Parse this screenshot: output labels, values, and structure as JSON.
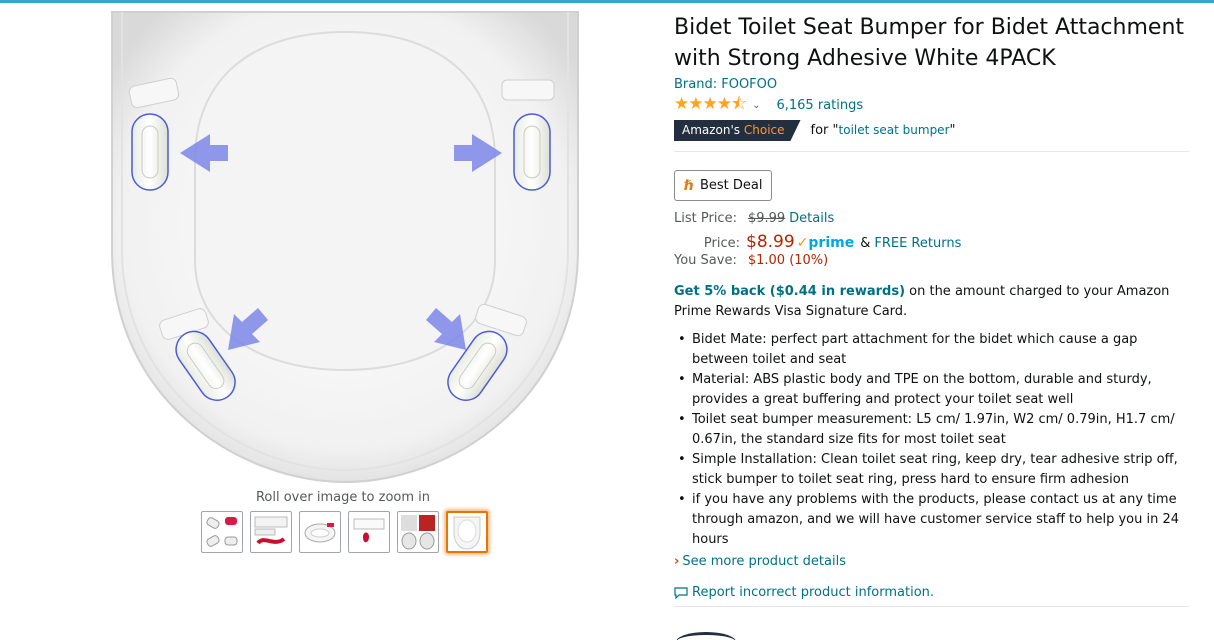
{
  "image": {
    "zoom_hint": "Roll over image to zoom in",
    "thumbnails": [
      {
        "name": "thumb-1",
        "selected": false
      },
      {
        "name": "thumb-2",
        "selected": false
      },
      {
        "name": "thumb-3",
        "selected": false
      },
      {
        "name": "thumb-4",
        "selected": false
      },
      {
        "name": "thumb-5",
        "selected": false
      },
      {
        "name": "thumb-6",
        "selected": true
      }
    ]
  },
  "product": {
    "title": "Bidet Toilet Seat Bumper for Bidet Attachment with Strong Adhesive White 4PACK",
    "brand": "Brand: FOOFOO",
    "rating_stars": 4.5,
    "ratings_count": "6,165 ratings",
    "choice_badge": {
      "prefix": "Amazon's",
      "highlight": "Choice"
    },
    "choice_for_prefix": "for \"",
    "choice_keyword": "toilet seat bumper",
    "choice_for_suffix": "\"",
    "deal_button": "Best Deal"
  },
  "pricing": {
    "list_price_label": "List Price:",
    "list_price": "$9.99",
    "details_link": "Details",
    "price_label": "Price:",
    "price": "$8.99",
    "prime_label": "prime",
    "amp": "&",
    "free_returns": "FREE Returns",
    "you_save_label": "You Save:",
    "you_save": "$1.00 (10%)"
  },
  "rewards": {
    "highlight": "Get 5% back ($0.44 in rewards)",
    "text": " on the amount charged to your Amazon Prime Rewards Visa Signature Card."
  },
  "bullets": [
    "Bidet Mate: perfect part attachment for the bidet which cause a gap between toilet and seat",
    "Material: ABS plastic body and TPE on the bottom, durable and sturdy, provides a great buffering and protect your toilet seat well",
    "Toilet seat bumper measurement: L5 cm/ 1.97in, W2 cm/ 0.79in, H1.7 cm/ 0.67in, the standard size fits for most toilet seat",
    "Simple Installation: Clean toilet seat ring, keep dry, tear adhesive strip off, stick bumper to toilet seat ring, press hard to ensure firm adhesion",
    "if you have any problems with the products, please contact us at any time through amazon, and we will have customer service staff to help you in 24 hours"
  ],
  "links": {
    "see_more": "See more product details",
    "report": "Report incorrect product information."
  },
  "colors": {
    "link": "#007185",
    "price": "#b12704",
    "star": "#ffa41c",
    "badge_bg": "#232f3e",
    "badge_accent": "#f69931"
  }
}
